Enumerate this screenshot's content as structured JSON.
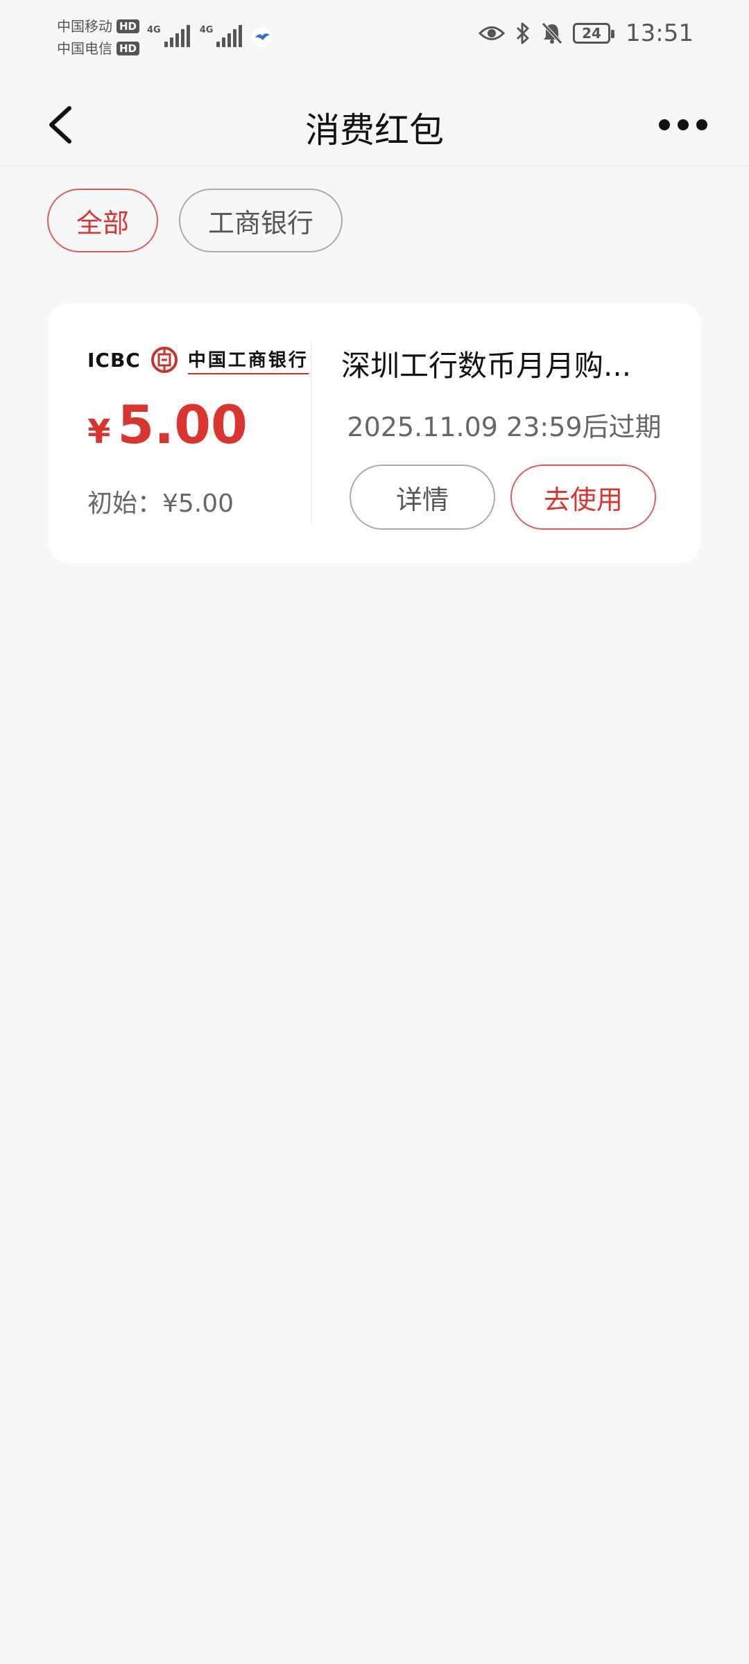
{
  "status_bar": {
    "carrier_1": "中国移动",
    "carrier_2": "中国电信",
    "hd_badge": "HD",
    "network_1": "4G",
    "network_2": "4G",
    "battery": "24",
    "time": "13:51"
  },
  "header": {
    "title": "消费红包"
  },
  "filters": [
    {
      "label": "全部",
      "active": true
    },
    {
      "label": "工商银行",
      "active": false
    }
  ],
  "voucher": {
    "bank_logo_latin": "ICBC",
    "bank_logo_cn": "中国工商银行",
    "currency_symbol": "¥",
    "amount": "5.00",
    "initial": "初始：¥5.00",
    "name": "深圳工行数币月月购...",
    "expiry": "2025.11.09 23:59后过期",
    "detail_label": "详情",
    "use_label": "去使用"
  },
  "colors": {
    "accent": "#d9352e",
    "background": "#f6f7f9"
  }
}
